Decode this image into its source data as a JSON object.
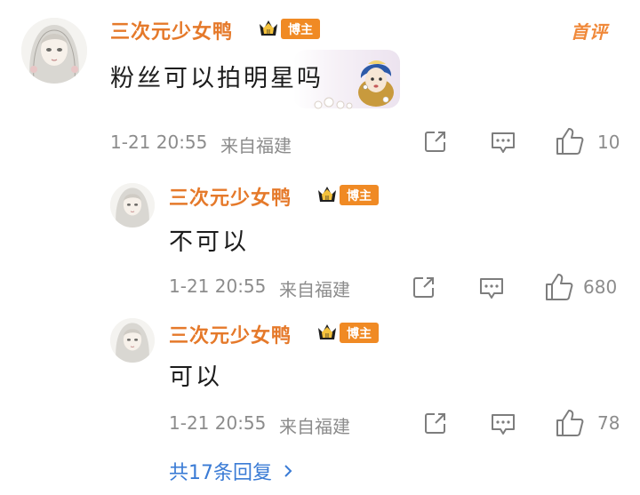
{
  "comment": {
    "author": "三次元少女鸭",
    "badge": "博主",
    "text": "粉丝可以拍明星吗",
    "time": "1-21 20:55",
    "location": "来自福建",
    "likes": "10",
    "first_label": "首评"
  },
  "replies": [
    {
      "author": "三次元少女鸭",
      "badge": "博主",
      "text": "不可以",
      "time": "1-21 20:55",
      "location": "来自福建",
      "likes": "680"
    },
    {
      "author": "三次元少女鸭",
      "badge": "博主",
      "text": "可以",
      "time": "1-21 20:55",
      "location": "来自福建",
      "likes": "78"
    }
  ],
  "more_replies": "共17条回复",
  "colors": {
    "username": "#e5792a",
    "badge": "#f08a24",
    "link": "#3a7bd5",
    "meta": "#8c8c8c"
  }
}
